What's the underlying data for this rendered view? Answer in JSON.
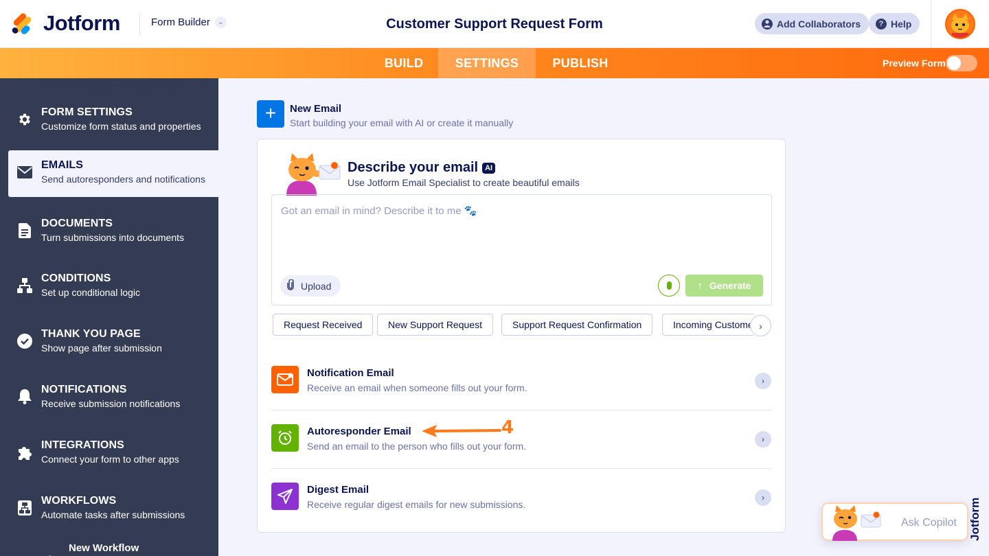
{
  "header": {
    "logo_text": "Jotform",
    "builder_label": "Form Builder",
    "form_title": "Customer Support Request Form",
    "add_collaborators": "Add Collaborators",
    "help": "Help"
  },
  "nav": {
    "tabs": [
      "BUILD",
      "SETTINGS",
      "PUBLISH"
    ],
    "active_tab": "SETTINGS",
    "preview_label": "Preview Form",
    "preview_on": false
  },
  "sidebar": {
    "items": [
      {
        "title": "FORM SETTINGS",
        "subtitle": "Customize form status and properties",
        "icon": "gear-icon"
      },
      {
        "title": "EMAILS",
        "subtitle": "Send autoresponders and notifications",
        "icon": "envelope-icon"
      },
      {
        "title": "DOCUMENTS",
        "subtitle": "Turn submissions into documents",
        "icon": "document-icon"
      },
      {
        "title": "CONDITIONS",
        "subtitle": "Set up conditional logic",
        "icon": "conditions-icon"
      },
      {
        "title": "THANK YOU PAGE",
        "subtitle": "Show page after submission",
        "icon": "check-circle-icon"
      },
      {
        "title": "NOTIFICATIONS",
        "subtitle": "Receive submission notifications",
        "icon": "bell-icon"
      },
      {
        "title": "INTEGRATIONS",
        "subtitle": "Connect your form to other apps",
        "icon": "puzzle-icon"
      },
      {
        "title": "WORKFLOWS",
        "subtitle": "Automate tasks after submissions",
        "icon": "workflow-icon"
      }
    ],
    "active_item": "EMAILS",
    "new_workflow": "New Workflow"
  },
  "main": {
    "new_email": {
      "title": "New Email",
      "subtitle": "Start building your email with AI or create it manually"
    },
    "ai_card": {
      "title": "Describe your email",
      "ai_badge": "AI",
      "subtitle": "Use Jotform Email Specialist to create beautiful emails",
      "placeholder": "Got an email in mind? Describe it to me 🐾",
      "upload_label": "Upload",
      "generate_label": "Generate",
      "suggestions": [
        "Request Received",
        "New Support Request",
        "Support Request Confirmation",
        "Incoming Customer Request"
      ]
    },
    "email_types": [
      {
        "title": "Notification Email",
        "subtitle": "Receive an email when someone fills out your form.",
        "color": "#ff6100",
        "icon": "notification-envelope-icon"
      },
      {
        "title": "Autoresponder Email",
        "subtitle": "Send an email to the person who fills out your form.",
        "color": "#64b200",
        "icon": "alarm-clock-icon"
      },
      {
        "title": "Digest Email",
        "subtitle": "Receive regular digest emails for new submissions.",
        "color": "#8b32d1",
        "icon": "paper-plane-icon"
      }
    ],
    "annotation_number": "4"
  },
  "copilot": {
    "label": "Ask Copilot",
    "badge_text": "Jotform"
  }
}
